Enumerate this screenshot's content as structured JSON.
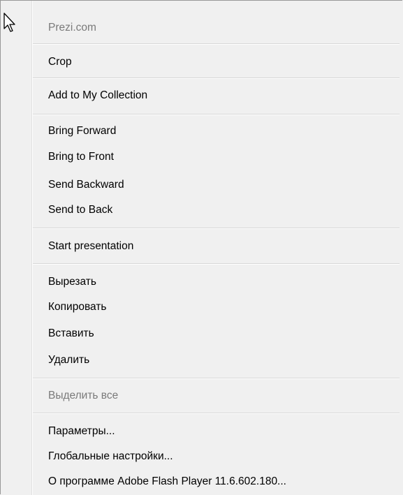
{
  "menu": {
    "items": [
      {
        "label": "Prezi.com",
        "enabled": false
      },
      {
        "label": "Crop",
        "enabled": true
      },
      {
        "label": "Add to My Collection",
        "enabled": true
      },
      {
        "label": "Bring Forward",
        "enabled": true
      },
      {
        "label": "Bring to Front",
        "enabled": true
      },
      {
        "label": "Send Backward",
        "enabled": true
      },
      {
        "label": "Send to Back",
        "enabled": true
      },
      {
        "label": "Start presentation",
        "enabled": true
      },
      {
        "label": "Вырезать",
        "enabled": true
      },
      {
        "label": "Копировать",
        "enabled": true
      },
      {
        "label": "Вставить",
        "enabled": true
      },
      {
        "label": "Удалить",
        "enabled": true
      },
      {
        "label": "Выделить все",
        "enabled": false
      },
      {
        "label": "Параметры...",
        "enabled": true
      },
      {
        "label": "Глобальные настройки...",
        "enabled": true
      },
      {
        "label": "О программе Adobe Flash Player 11.6.602.180...",
        "enabled": true
      }
    ]
  },
  "cursor": {
    "icon": "mouse-pointer-icon"
  }
}
